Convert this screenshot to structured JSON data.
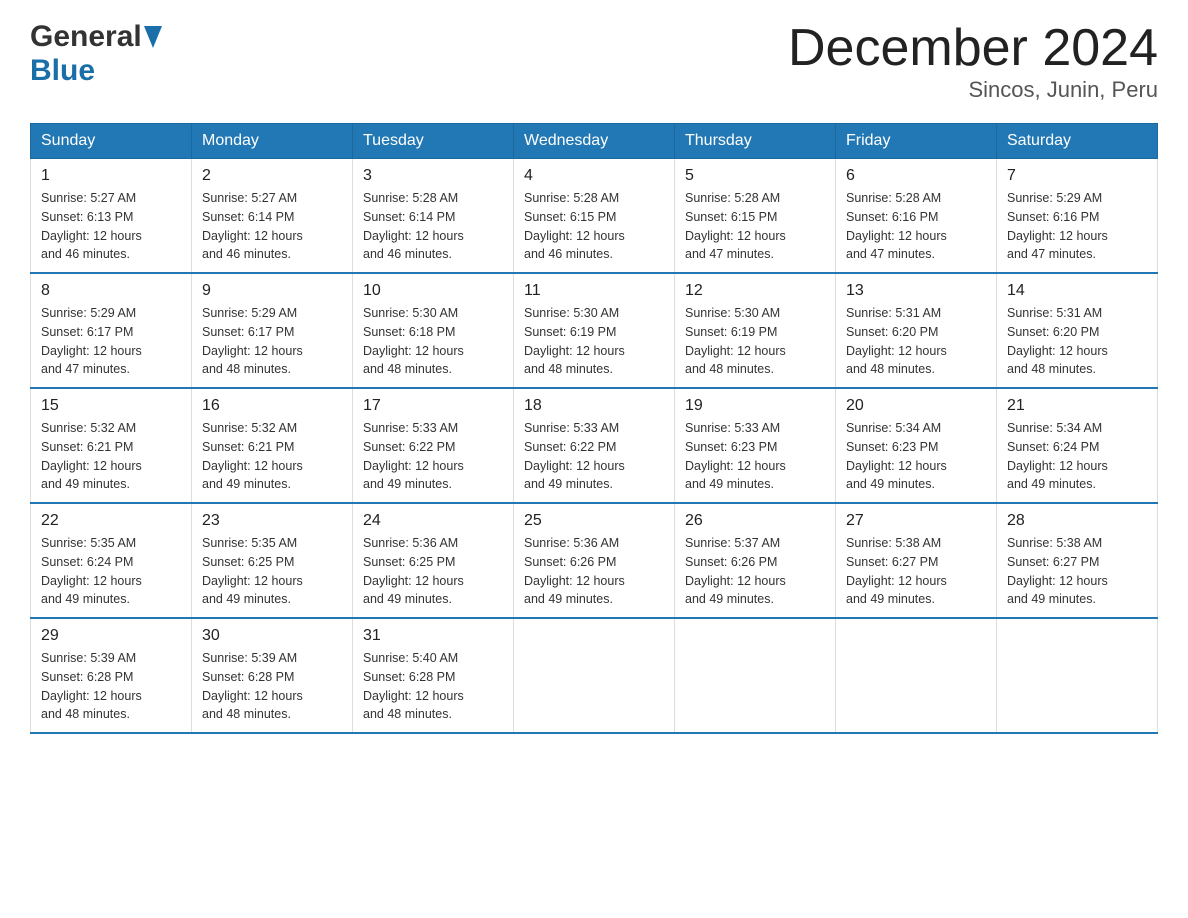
{
  "header": {
    "logo_general": "General",
    "logo_blue": "Blue",
    "title": "December 2024",
    "subtitle": "Sincos, Junin, Peru"
  },
  "days_of_week": [
    "Sunday",
    "Monday",
    "Tuesday",
    "Wednesday",
    "Thursday",
    "Friday",
    "Saturday"
  ],
  "weeks": [
    [
      {
        "day": "1",
        "info": "Sunrise: 5:27 AM\nSunset: 6:13 PM\nDaylight: 12 hours\nand 46 minutes."
      },
      {
        "day": "2",
        "info": "Sunrise: 5:27 AM\nSunset: 6:14 PM\nDaylight: 12 hours\nand 46 minutes."
      },
      {
        "day": "3",
        "info": "Sunrise: 5:28 AM\nSunset: 6:14 PM\nDaylight: 12 hours\nand 46 minutes."
      },
      {
        "day": "4",
        "info": "Sunrise: 5:28 AM\nSunset: 6:15 PM\nDaylight: 12 hours\nand 46 minutes."
      },
      {
        "day": "5",
        "info": "Sunrise: 5:28 AM\nSunset: 6:15 PM\nDaylight: 12 hours\nand 47 minutes."
      },
      {
        "day": "6",
        "info": "Sunrise: 5:28 AM\nSunset: 6:16 PM\nDaylight: 12 hours\nand 47 minutes."
      },
      {
        "day": "7",
        "info": "Sunrise: 5:29 AM\nSunset: 6:16 PM\nDaylight: 12 hours\nand 47 minutes."
      }
    ],
    [
      {
        "day": "8",
        "info": "Sunrise: 5:29 AM\nSunset: 6:17 PM\nDaylight: 12 hours\nand 47 minutes."
      },
      {
        "day": "9",
        "info": "Sunrise: 5:29 AM\nSunset: 6:17 PM\nDaylight: 12 hours\nand 48 minutes."
      },
      {
        "day": "10",
        "info": "Sunrise: 5:30 AM\nSunset: 6:18 PM\nDaylight: 12 hours\nand 48 minutes."
      },
      {
        "day": "11",
        "info": "Sunrise: 5:30 AM\nSunset: 6:19 PM\nDaylight: 12 hours\nand 48 minutes."
      },
      {
        "day": "12",
        "info": "Sunrise: 5:30 AM\nSunset: 6:19 PM\nDaylight: 12 hours\nand 48 minutes."
      },
      {
        "day": "13",
        "info": "Sunrise: 5:31 AM\nSunset: 6:20 PM\nDaylight: 12 hours\nand 48 minutes."
      },
      {
        "day": "14",
        "info": "Sunrise: 5:31 AM\nSunset: 6:20 PM\nDaylight: 12 hours\nand 48 minutes."
      }
    ],
    [
      {
        "day": "15",
        "info": "Sunrise: 5:32 AM\nSunset: 6:21 PM\nDaylight: 12 hours\nand 49 minutes."
      },
      {
        "day": "16",
        "info": "Sunrise: 5:32 AM\nSunset: 6:21 PM\nDaylight: 12 hours\nand 49 minutes."
      },
      {
        "day": "17",
        "info": "Sunrise: 5:33 AM\nSunset: 6:22 PM\nDaylight: 12 hours\nand 49 minutes."
      },
      {
        "day": "18",
        "info": "Sunrise: 5:33 AM\nSunset: 6:22 PM\nDaylight: 12 hours\nand 49 minutes."
      },
      {
        "day": "19",
        "info": "Sunrise: 5:33 AM\nSunset: 6:23 PM\nDaylight: 12 hours\nand 49 minutes."
      },
      {
        "day": "20",
        "info": "Sunrise: 5:34 AM\nSunset: 6:23 PM\nDaylight: 12 hours\nand 49 minutes."
      },
      {
        "day": "21",
        "info": "Sunrise: 5:34 AM\nSunset: 6:24 PM\nDaylight: 12 hours\nand 49 minutes."
      }
    ],
    [
      {
        "day": "22",
        "info": "Sunrise: 5:35 AM\nSunset: 6:24 PM\nDaylight: 12 hours\nand 49 minutes."
      },
      {
        "day": "23",
        "info": "Sunrise: 5:35 AM\nSunset: 6:25 PM\nDaylight: 12 hours\nand 49 minutes."
      },
      {
        "day": "24",
        "info": "Sunrise: 5:36 AM\nSunset: 6:25 PM\nDaylight: 12 hours\nand 49 minutes."
      },
      {
        "day": "25",
        "info": "Sunrise: 5:36 AM\nSunset: 6:26 PM\nDaylight: 12 hours\nand 49 minutes."
      },
      {
        "day": "26",
        "info": "Sunrise: 5:37 AM\nSunset: 6:26 PM\nDaylight: 12 hours\nand 49 minutes."
      },
      {
        "day": "27",
        "info": "Sunrise: 5:38 AM\nSunset: 6:27 PM\nDaylight: 12 hours\nand 49 minutes."
      },
      {
        "day": "28",
        "info": "Sunrise: 5:38 AM\nSunset: 6:27 PM\nDaylight: 12 hours\nand 49 minutes."
      }
    ],
    [
      {
        "day": "29",
        "info": "Sunrise: 5:39 AM\nSunset: 6:28 PM\nDaylight: 12 hours\nand 48 minutes."
      },
      {
        "day": "30",
        "info": "Sunrise: 5:39 AM\nSunset: 6:28 PM\nDaylight: 12 hours\nand 48 minutes."
      },
      {
        "day": "31",
        "info": "Sunrise: 5:40 AM\nSunset: 6:28 PM\nDaylight: 12 hours\nand 48 minutes."
      },
      {
        "day": "",
        "info": ""
      },
      {
        "day": "",
        "info": ""
      },
      {
        "day": "",
        "info": ""
      },
      {
        "day": "",
        "info": ""
      }
    ]
  ]
}
